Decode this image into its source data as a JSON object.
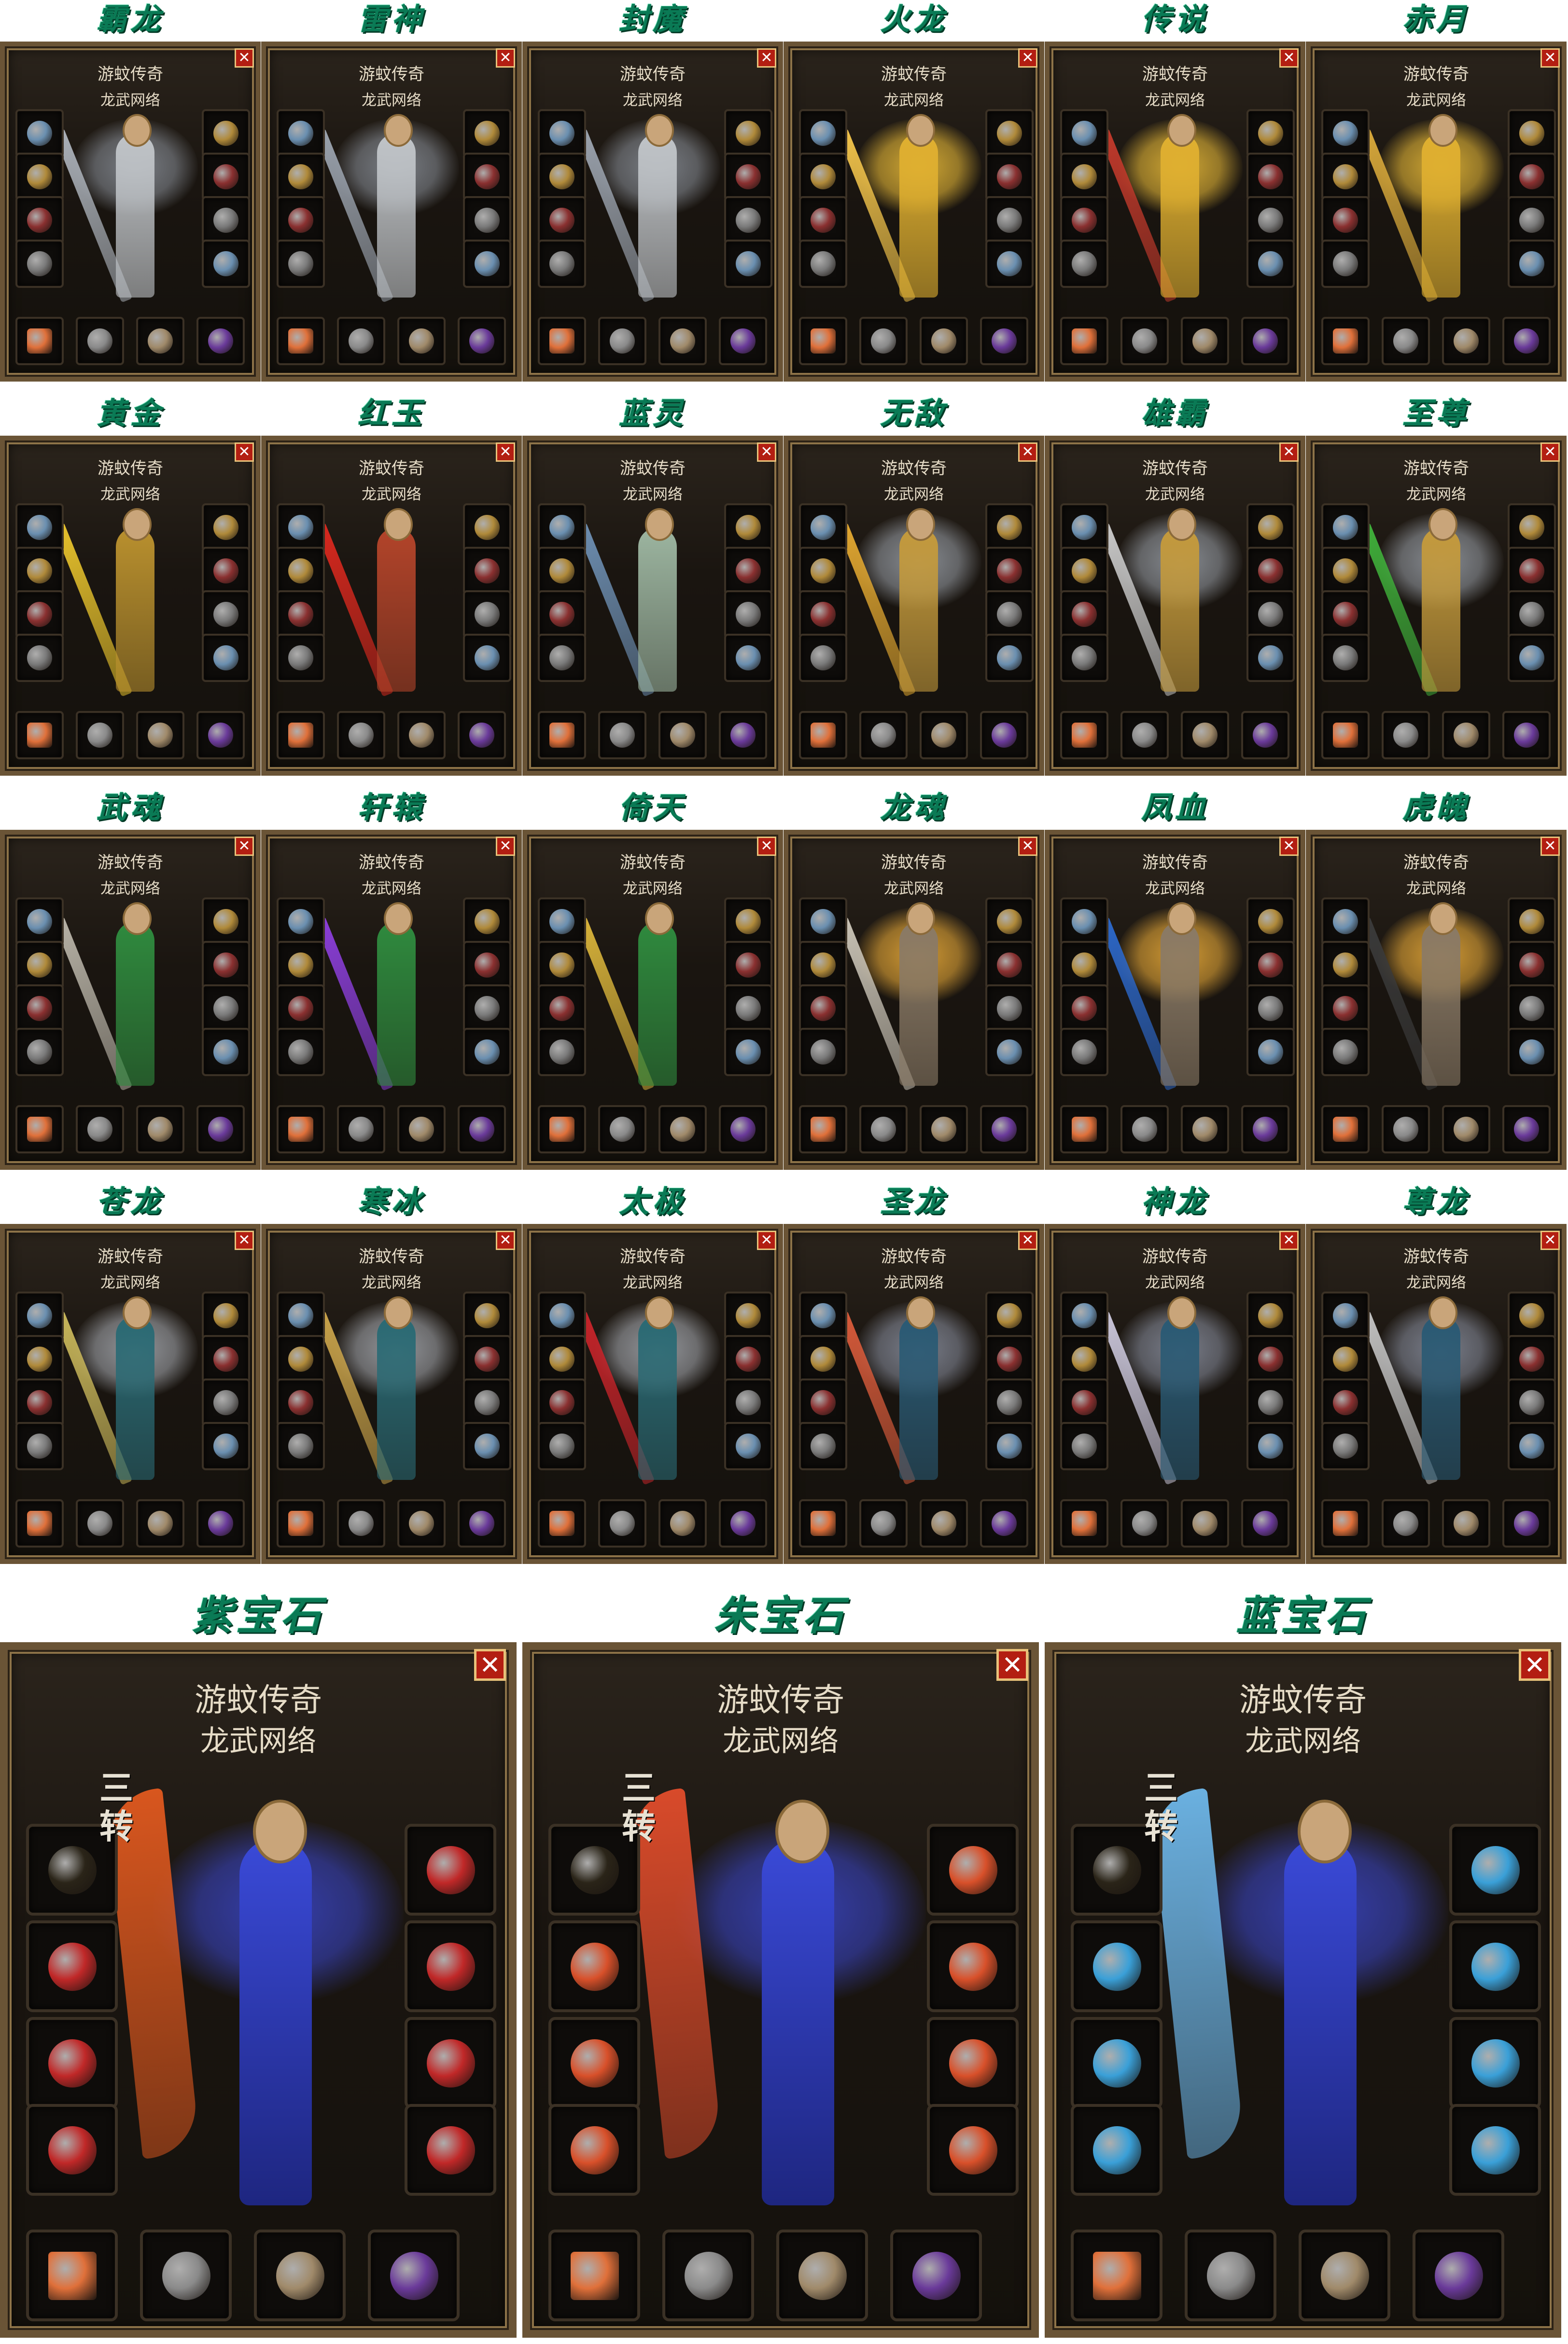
{
  "window": {
    "title_line1": "游蚊传奇",
    "title_line2": "龙武网络",
    "close_icon": "close-icon"
  },
  "sets": [
    {
      "name": "霸龙",
      "theme": "#c0c4c8",
      "wings": "#8a9099",
      "weapon": "#aab0b8"
    },
    {
      "name": "雷神",
      "theme": "#c0c4c8",
      "wings": "#8a9099",
      "weapon": "#9aa2ad"
    },
    {
      "name": "封魔",
      "theme": "#c0c4c8",
      "wings": "#8a9099",
      "weapon": "#9aa2ad"
    },
    {
      "name": "火龙",
      "theme": "#e0b030",
      "wings": "#f2c23a",
      "weapon": "#f0c24a"
    },
    {
      "name": "传说",
      "theme": "#e0b030",
      "wings": "#f2c23a",
      "weapon": "#c0392b"
    },
    {
      "name": "赤月",
      "theme": "#e0b030",
      "wings": "#f2c23a",
      "weapon": "#d6a73a"
    },
    {
      "name": "黄金",
      "theme": "#b9902e",
      "wings": "",
      "weapon": "#e6c12c"
    },
    {
      "name": "红玉",
      "theme": "#b3442a",
      "wings": "",
      "weapon": "#d8281e"
    },
    {
      "name": "蓝灵",
      "theme": "#9cb5a0",
      "wings": "",
      "weapon": "#6c8db0"
    },
    {
      "name": "无敌",
      "theme": "#c49a3c",
      "wings": "#9aa0a8",
      "weapon": "#e0a630"
    },
    {
      "name": "雄霸",
      "theme": "#c49a3c",
      "wings": "#9aa0a8",
      "weapon": "#c8c8c8"
    },
    {
      "name": "至尊",
      "theme": "#c49a3c",
      "wings": "#9aa0a8",
      "weapon": "#3fae3a"
    },
    {
      "name": "武魂",
      "theme": "#2f8a3e",
      "wings": "",
      "weapon": "#b7b2a6"
    },
    {
      "name": "轩辕",
      "theme": "#2f8a3e",
      "wings": "",
      "weapon": "#8a3ed8"
    },
    {
      "name": "倚天",
      "theme": "#2f8a3e",
      "wings": "",
      "weapon": "#d7b23a"
    },
    {
      "name": "龙魂",
      "theme": "#8a7a66",
      "wings": "#f2b13a",
      "weapon": "#c8c2b5"
    },
    {
      "name": "凤血",
      "theme": "#8a7a66",
      "wings": "#f2b13a",
      "weapon": "#2c67c8"
    },
    {
      "name": "虎魄",
      "theme": "#8a7a66",
      "wings": "#f2b13a",
      "weapon": "#3a3a3a"
    },
    {
      "name": "苍龙",
      "theme": "#2a6a74",
      "wings": "#a9adb4",
      "weapon": "#c8b65a"
    },
    {
      "name": "寒冰",
      "theme": "#2a6a74",
      "wings": "#a9adb4",
      "weapon": "#c8a24a"
    },
    {
      "name": "太极",
      "theme": "#2a6a74",
      "wings": "#a9adb4",
      "weapon": "#c6242a"
    },
    {
      "name": "圣龙",
      "theme": "#2a5a74",
      "wings": "#8a90a0",
      "weapon": "#d65a3a"
    },
    {
      "name": "神龙",
      "theme": "#2a5a74",
      "wings": "#8a90a0",
      "weapon": "#c8c4d8"
    },
    {
      "name": "尊龙",
      "theme": "#2a5a74",
      "wings": "#8a90a0",
      "weapon": "#c0c0c0"
    }
  ],
  "big_sets": [
    {
      "name": "紫宝石",
      "zhuan_top": "三",
      "zhuan_bottom": "转",
      "wings": "#3a46c8",
      "weapon": "#d8561e",
      "gem": "#c02828"
    },
    {
      "name": "朱宝石",
      "zhuan_top": "三",
      "zhuan_bottom": "转",
      "wings": "#3a46c8",
      "weapon": "#d84a2a",
      "gem": "#d8502a"
    },
    {
      "name": "蓝宝石",
      "zhuan_top": "三",
      "zhuan_bottom": "转",
      "wings": "#3a46c8",
      "weapon": "#6ab0e0",
      "gem": "#3aa0d8"
    }
  ]
}
